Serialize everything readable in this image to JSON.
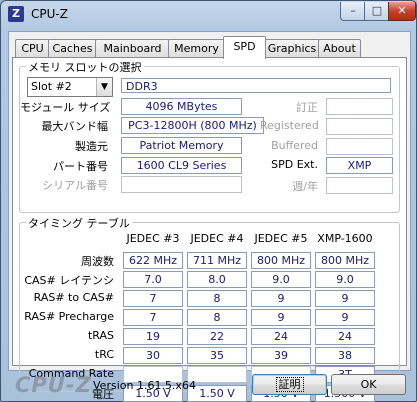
{
  "window": {
    "app_icon_letter": "Z",
    "title": "CPU-Z",
    "minimize_glyph": "–",
    "maximize_glyph": "□",
    "close_glyph": "✕"
  },
  "tabs": [
    "CPU",
    "Caches",
    "Mainboard",
    "Memory",
    "SPD",
    "Graphics",
    "About"
  ],
  "active_tab": "SPD",
  "slot": {
    "group_title": "メモリ スロットの選択",
    "selected": "Slot #2",
    "dropdown_glyph": "▼",
    "type": "DDR3",
    "rows": {
      "module_size_label": "モジュール サイズ",
      "module_size": "4096 MBytes",
      "max_bw_label": "最大バンド幅",
      "max_bw": "PC3-12800H (800 MHz)",
      "manufacturer_label": "製造元",
      "manufacturer": "Patriot Memory",
      "part_label": "パート番号",
      "part": "1600 CL9 Series",
      "serial_label": "シリアル番号",
      "serial": ""
    },
    "right": {
      "correction_label": "訂正",
      "correction": "",
      "registered_label": "Registered",
      "registered": "",
      "buffered_label": "Buffered",
      "buffered": "",
      "spd_ext_label": "SPD Ext.",
      "spd_ext": "XMP",
      "week_year_label": "週/年",
      "week_year": ""
    }
  },
  "timings": {
    "group_title": "タイミング テーブル",
    "columns": [
      "JEDEC #3",
      "JEDEC #4",
      "JEDEC #5",
      "XMP-1600"
    ],
    "rows": [
      {
        "label": "周波数",
        "values": [
          "622 MHz",
          "711 MHz",
          "800 MHz",
          "800 MHz"
        ]
      },
      {
        "label": "CAS# レイテンシ",
        "values": [
          "7.0",
          "8.0",
          "9.0",
          "9.0"
        ]
      },
      {
        "label": "RAS# to CAS#",
        "values": [
          "7",
          "8",
          "9",
          "9"
        ]
      },
      {
        "label": "RAS# Precharge",
        "values": [
          "7",
          "8",
          "9",
          "9"
        ]
      },
      {
        "label": "tRAS",
        "values": [
          "19",
          "22",
          "24",
          "24"
        ]
      },
      {
        "label": "tRC",
        "values": [
          "30",
          "35",
          "39",
          "38"
        ]
      },
      {
        "label": "Command Rate",
        "values": [
          "",
          "",
          "",
          "3T"
        ]
      },
      {
        "label": "電圧",
        "values": [
          "1.50 V",
          "1.50 V",
          "1.50 V",
          "1.500 V"
        ]
      }
    ]
  },
  "footer": {
    "logo": "CPU-Z",
    "version": "Version 1.61.5.x64",
    "about_button": "証明",
    "ok_button": "OK"
  }
}
